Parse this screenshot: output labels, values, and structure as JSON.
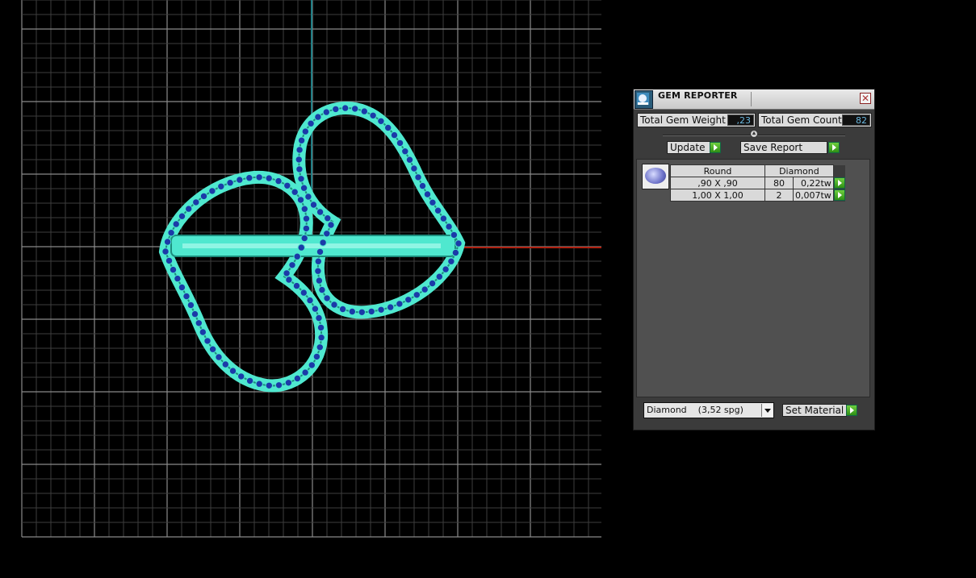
{
  "gem_reporter": {
    "title": "GEM REPORTER",
    "close_glyph": "✕",
    "total_gem_weight_label": "Total Gem Weight",
    "total_gem_weight_value": ",23",
    "total_gem_count_label": "Total Gem Count",
    "total_gem_count_value": "82",
    "update_label": "Update",
    "save_report_label": "Save Report",
    "table": {
      "headers": [
        "Round",
        "Diamond"
      ],
      "rows": [
        {
          "size": ",90 X ,90",
          "count": "80",
          "weight": "0,22tw"
        },
        {
          "size": "1,00 X 1,00",
          "count": "2",
          "weight": "0,007tw"
        }
      ]
    },
    "material_select_value": "Diamond    (3,52 spg)",
    "set_material_label": "Set Material"
  },
  "colors": {
    "ring_fill": "#4fe8cf",
    "ring_stroke": "#1d8e7e",
    "gem_blue": "#1b3aa8",
    "grid_line": "#6f6f6f",
    "axis_red": "#b02010",
    "axis_teal": "#1f7f86",
    "value_text": "#6ab8e0"
  }
}
